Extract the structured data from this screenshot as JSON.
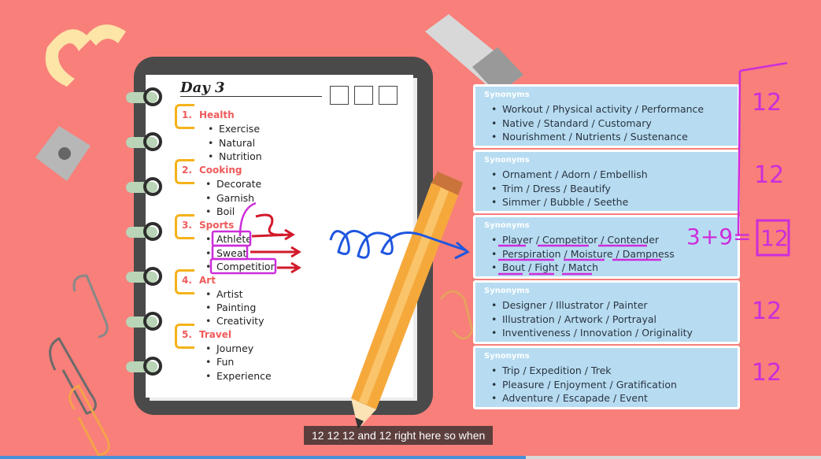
{
  "day_title": "Day 3",
  "categories": [
    {
      "num": "1.",
      "name": "Health",
      "words": [
        "Exercise",
        "Natural",
        "Nutrition"
      ]
    },
    {
      "num": "2.",
      "name": "Cooking",
      "words": [
        "Decorate",
        "Garnish",
        "Boil"
      ]
    },
    {
      "num": "3.",
      "name": "Sports",
      "words": [
        "Athlete",
        "Sweat",
        "Competition"
      ]
    },
    {
      "num": "4.",
      "name": "Art",
      "words": [
        "Artist",
        "Painting",
        "Creativity"
      ]
    },
    {
      "num": "5.",
      "name": "Travel",
      "words": [
        "Journey",
        "Fun",
        "Experience"
      ]
    }
  ],
  "synonym_cards": [
    {
      "header": "Synonyms",
      "lines": [
        "Workout / Physical activity / Performance",
        "Native / Standard / Customary",
        "Nourishment / Nutrients / Sustenance"
      ]
    },
    {
      "header": "Synonyms",
      "lines": [
        "Ornament / Adorn / Embellish",
        "Trim / Dress / Beautify",
        "Simmer / Bubble / Seethe"
      ]
    },
    {
      "header": "Synonyms",
      "lines": [
        "Player / Competitor / Contender",
        "Perspiration / Moisture / Dampness",
        "Bout / Fight / Match"
      ]
    },
    {
      "header": "Synonyms",
      "lines": [
        "Designer / Illustrator / Painter",
        "Illustration / Artwork / Portrayal",
        "Inventiveness / Innovation / Originality"
      ]
    },
    {
      "header": "Synonyms",
      "lines": [
        "Trip / Expedition / Trek",
        "Pleasure / Enjoyment / Gratification",
        "Adventure / Escapade / Event"
      ]
    }
  ],
  "annotations": {
    "count_1": "12",
    "count_2": "12",
    "equation": "3+9=",
    "equation_result": "12",
    "count_4": "12",
    "count_5": "12"
  },
  "caption": "12 12 12 and 12 right here so when",
  "video_progress": 0.64,
  "colors": {
    "background": "#f87f7a",
    "card": "#b7dcf1",
    "category": "#ef5a5a",
    "highlight_box": "#f5b21a",
    "annotation_purple": "#cc2ddb",
    "annotation_red": "#d21a2a",
    "annotation_blue": "#1f56e0"
  }
}
